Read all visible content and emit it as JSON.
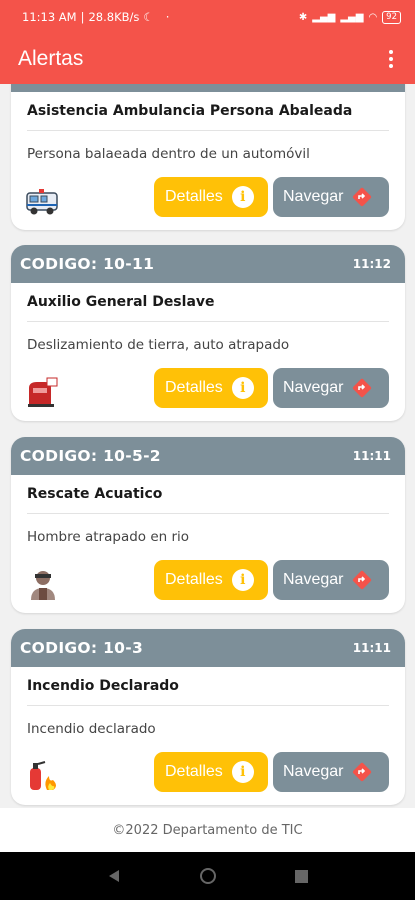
{
  "status": {
    "time": "11:13 AM",
    "speed": "28.8KB/s",
    "battery": "92"
  },
  "app": {
    "title": "Alertas"
  },
  "cards": [
    {
      "code": "",
      "time": "",
      "title": "Asistencia Ambulancia Persona Abaleada",
      "description": "Persona balaeada dentro de un automóvil",
      "icon": "ambulance-icon"
    },
    {
      "code": "CODIGO: 10-11",
      "time": "11:12",
      "title": "Auxilio General Deslave",
      "description": "Deslizamiento de tierra, auto atrapado",
      "icon": "landslide-icon"
    },
    {
      "code": "CODIGO: 10-5-2",
      "time": "11:11",
      "title": "Rescate Acuatico",
      "description": "Hombre atrapado en rio",
      "icon": "rescuer-icon"
    },
    {
      "code": "CODIGO: 10-3",
      "time": "11:11",
      "title": "Incendio Declarado",
      "description": "Incendio declarado",
      "icon": "fire-extinguisher-icon"
    }
  ],
  "buttons": {
    "details": "Detalles",
    "navigate": "Navegar"
  },
  "footer": {
    "text": "©2022 Departamento de TIC"
  },
  "colors": {
    "accent": "#f4534a",
    "header": "#7d8f99",
    "details": "#ffc107",
    "navigate_icon": "#f4534a"
  }
}
